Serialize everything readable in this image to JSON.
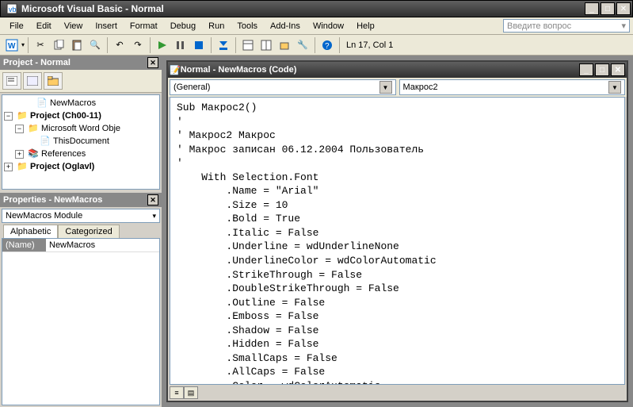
{
  "title": "Microsoft Visual Basic - Normal",
  "menu": [
    "File",
    "Edit",
    "View",
    "Insert",
    "Format",
    "Debug",
    "Run",
    "Tools",
    "Add-Ins",
    "Window",
    "Help"
  ],
  "askbox": "Введите вопрос",
  "status": "Ln 17, Col 1",
  "project_panel": {
    "title": "Project - Normal"
  },
  "tree": {
    "newmacros": "NewMacros",
    "proj1": "Project (Ch00-11)",
    "wordobj": "Microsoft Word Obje",
    "thisdoc": "ThisDocument",
    "refs": "References",
    "proj2": "Project (Oglavl)"
  },
  "props_panel": {
    "title": "Properties - NewMacros"
  },
  "prop_select": "NewMacros Module",
  "tabs": {
    "a": "Alphabetic",
    "c": "Categorized"
  },
  "prop_row": {
    "name": "(Name)",
    "val": "NewMacros"
  },
  "codewin_title": "Normal - NewMacros (Code)",
  "dd1": "(General)",
  "dd2": "Макрос2",
  "code": "Sub Макрос2()\n'\n' Макрос2 Макрос\n' Макрос записан 06.12.2004 Пользователь\n'\n    With Selection.Font\n        .Name = \"Arial\"\n        .Size = 10\n        .Bold = True\n        .Italic = False\n        .Underline = wdUnderlineNone\n        .UnderlineColor = wdColorAutomatic\n        .StrikeThrough = False\n        .DoubleStrikeThrough = False\n        .Outline = False\n        .Emboss = False\n        .Shadow = False\n        .Hidden = False\n        .SmallCaps = False\n        .AllCaps = False\n        .Color = wdColorAutomatic"
}
